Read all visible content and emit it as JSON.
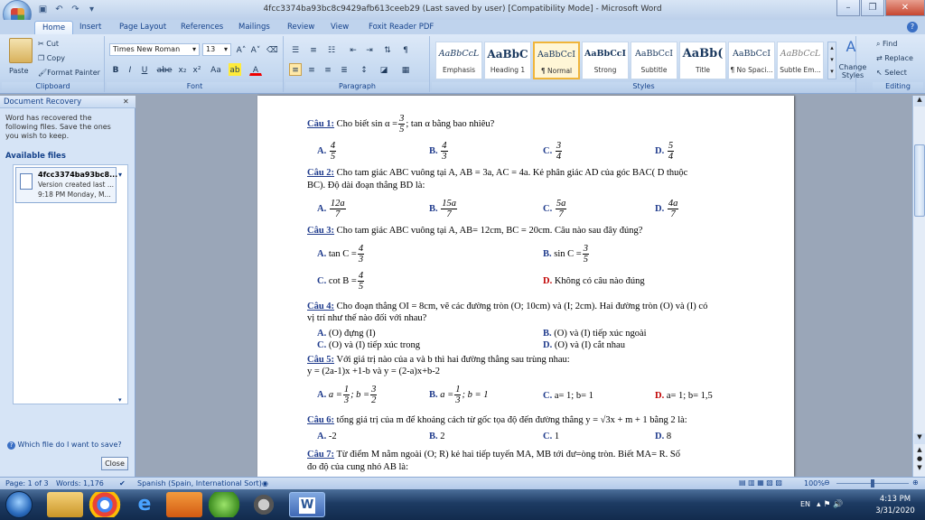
{
  "window": {
    "title": "4fcc3374ba93bc8c9429afb613ceeb29 (Last saved by user) [Compatibility Mode] - Microsoft Word"
  },
  "tabs": [
    "Home",
    "Insert",
    "Page Layout",
    "References",
    "Mailings",
    "Review",
    "View",
    "Foxit Reader PDF"
  ],
  "clipboard": {
    "paste": "Paste",
    "cut": "Cut",
    "copy": "Copy",
    "format_painter": "Format Painter",
    "label": "Clipboard"
  },
  "font": {
    "name": "Times New Roman",
    "size": "13",
    "label": "Font",
    "bold": "B",
    "italic": "I",
    "underline": "U",
    "strike": "abe",
    "sub": "x₂",
    "sup": "x²",
    "case": "Aa"
  },
  "paragraph": {
    "label": "Paragraph"
  },
  "styles": {
    "label": "Styles",
    "items": [
      {
        "preview": "AaBbCcL",
        "name": "Emphasis"
      },
      {
        "preview": "AaBbC",
        "name": "Heading 1"
      },
      {
        "preview": "AaBbCcI",
        "name": "¶ Normal"
      },
      {
        "preview": "AaBbCcI",
        "name": "Strong"
      },
      {
        "preview": "AaBbCcI",
        "name": "Subtitle"
      },
      {
        "preview": "AaBb(",
        "name": "Title"
      },
      {
        "preview": "AaBbCcI",
        "name": "¶ No Spaci..."
      },
      {
        "preview": "AaBbCcL",
        "name": "Subtle Em..."
      }
    ],
    "change_styles": "Change Styles"
  },
  "editing": {
    "label": "Editing",
    "find": "Find",
    "replace": "Replace",
    "select": "Select"
  },
  "recovery": {
    "title": "Document Recovery",
    "message": "Word has recovered the following files.  Save the ones you wish to keep.",
    "available": "Available files",
    "file_name": "4fcc3374ba93bc8...",
    "file_version": "Version created last ...",
    "file_time": "9:18 PM Monday, M...",
    "help": "Which file do I want to save?",
    "close": "Close"
  },
  "doc": {
    "q1_label": "Câu 1:",
    "q1_text": "Cho biết sin α =",
    "q1_frac": [
      "3",
      "5"
    ],
    "q1_tail": "; tan α  bằng bao nhiêu?",
    "q1_opts": [
      {
        "l": "A.",
        "n": "4",
        "d": "5"
      },
      {
        "l": "B.",
        "n": "4",
        "d": "3"
      },
      {
        "l": "C.",
        "n": "3",
        "d": "4"
      },
      {
        "l": "D.",
        "n": "5",
        "d": "4"
      }
    ],
    "q2_label": "Câu 2:",
    "q2_line1": "Cho tam giác ABC vuông tại A, AB = 3a, AC = 4a. Kẻ phân giác AD của góc BAC( D thuộc",
    "q2_line2": "BC). Độ dài đoạn thẳng BD là:",
    "q2_opts": [
      {
        "l": "A.",
        "n": "12a",
        "d": "7"
      },
      {
        "l": "B.",
        "n": "15a",
        "d": "7"
      },
      {
        "l": "C.",
        "n": "5a",
        "d": "7"
      },
      {
        "l": "D.",
        "n": "4a",
        "d": "7"
      }
    ],
    "q3_label": "Câu 3:",
    "q3_text": "Cho tam giác ABC vuông tại A, AB= 12cm, BC = 20cm. Câu nào sau đây đúng?",
    "q3_a_l": "A.",
    "q3_a": "tan C =",
    "q3_a_f": [
      "4",
      "3"
    ],
    "q3_b_l": "B.",
    "q3_b": "sin C =",
    "q3_b_f": [
      "3",
      "5"
    ],
    "q3_c_l": "C.",
    "q3_c": "cot B =",
    "q3_c_f": [
      "4",
      "5"
    ],
    "q3_d_l": "D.",
    "q3_d": "Không có câu nào đúng",
    "q4_label": "Câu 4:",
    "q4_line1": "Cho đoạn thẳng OI = 8cm, vẽ các đường tròn (O; 10cm) và (I; 2cm). Hai đường tròn (O) và (I) có",
    "q4_line2": "vị trí như thế nào đối với nhau?",
    "q4_opts": [
      {
        "l": "A.",
        "t": "(O) đựng (I)"
      },
      {
        "l": "B.",
        "t": "(O) và (I) tiếp xúc ngoài"
      },
      {
        "l": "C.",
        "t": "(O) và (I) tiếp xúc  trong"
      },
      {
        "l": "D.",
        "t": "(O) và (I) cắt nhau"
      }
    ],
    "q5_label": "Câu 5:",
    "q5_line1": "Với giá trị nào của a và b thì hai đường thẳng sau trùng nhau:",
    "q5_line2": "y = (2a-1)x +1-b và y = (2-a)x+b-2",
    "q5_a_l": "A.",
    "q5_a_pre": "a =",
    "q5_a_f1": [
      "1",
      "3"
    ],
    "q5_a_mid": "; b =",
    "q5_a_f2": [
      "3",
      "2"
    ],
    "q5_b_l": "B.",
    "q5_b_pre": "a =",
    "q5_b_f": [
      "1",
      "3"
    ],
    "q5_b_tail": "; b = 1",
    "q5_c_l": "C.",
    "q5_c": "a= 1; b= 1",
    "q5_d_l": "D.",
    "q5_d": "a= 1; b= 1,5",
    "q6_label": "Câu 6:",
    "q6_text": "tổng giá trị của m để khoảng cách từ gốc tọa độ đến đường thẳng  y = √3x + m + 1 bằng 2 là:",
    "q6_opts": [
      {
        "l": "A.",
        "t": "-2"
      },
      {
        "l": "B.",
        "t": "2"
      },
      {
        "l": "C.",
        "t": "1"
      },
      {
        "l": "D.",
        "t": "8"
      }
    ],
    "q7_label": "Câu 7:",
    "q7_line1": "Từ điểm M nằm ngoài (O; R) kẻ hai tiếp tuyến MA, MB tới đư=òng tròn. Biết MA= R. Số",
    "q7_line2": "đo độ của cung nhỏ AB là:"
  },
  "status": {
    "page": "Page: 1 of 3",
    "words": "Words: 1,176",
    "lang": "Spanish (Spain, International Sort)",
    "zoom": "100%"
  },
  "taskbar": {
    "lang": "EN",
    "time": "4:13 PM",
    "date": "3/31/2020"
  }
}
